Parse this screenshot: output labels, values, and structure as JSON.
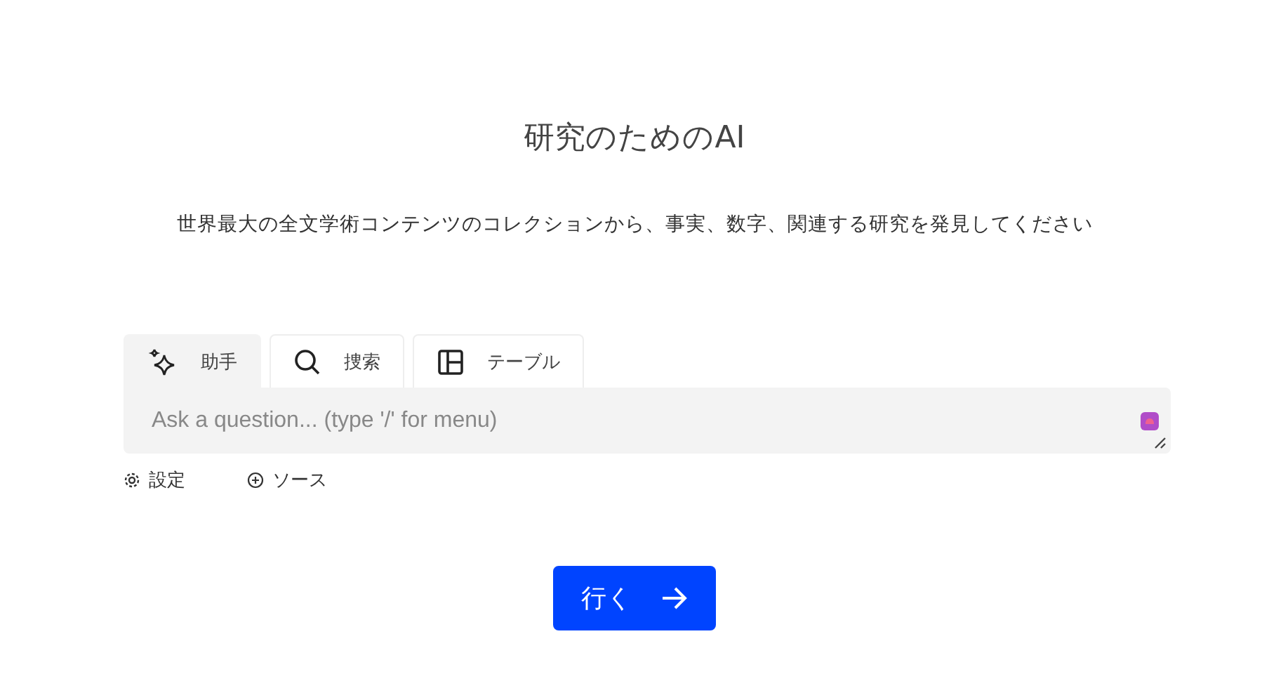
{
  "heading": "研究のためのAI",
  "subtitle": "世界最大の全文学術コンテンツのコレクションから、事実、数字、関連する研究を発見してください",
  "tabs": [
    {
      "kind": "sparkle",
      "label": "助手",
      "selected": true
    },
    {
      "kind": "search",
      "label": "捜索",
      "selected": false
    },
    {
      "kind": "table",
      "label": "テーブル",
      "selected": false
    }
  ],
  "question": {
    "placeholder": "Ask a question... (type '/' for menu)"
  },
  "options": [
    {
      "kind": "settings",
      "label": "設定"
    },
    {
      "kind": "add",
      "label": "ソース"
    }
  ],
  "go_button": {
    "label": "行く"
  }
}
